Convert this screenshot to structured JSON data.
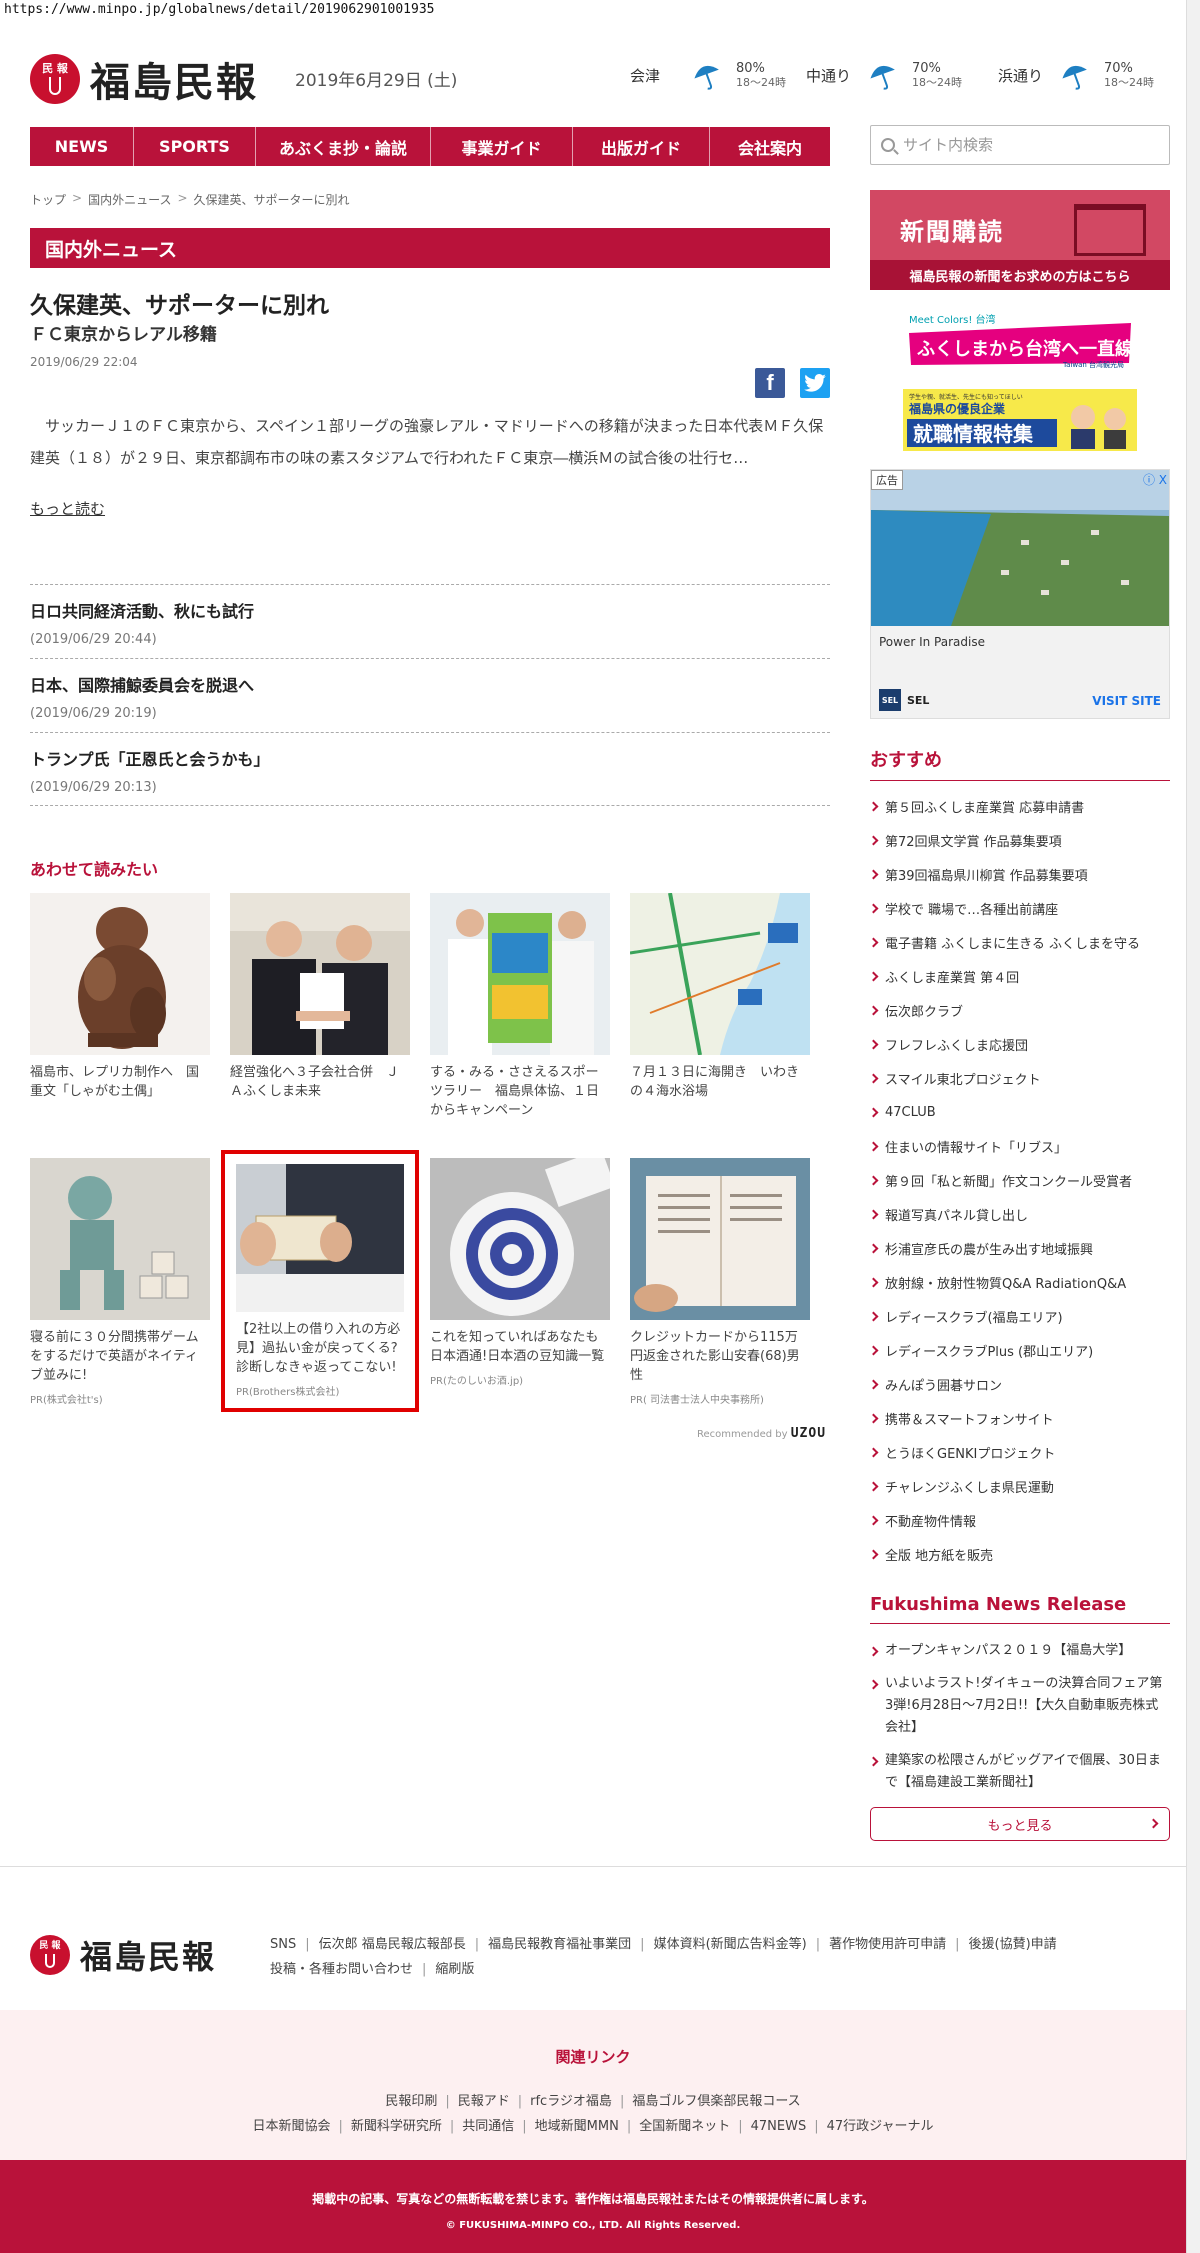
{
  "browser": {
    "url": "https://www.minpo.jp/globalnews/detail/2019062901001935"
  },
  "header": {
    "logo_mark_top": "民 報",
    "logo_text": "福島民報",
    "date": "2019年6月29日 (土)",
    "weather": [
      {
        "city": "会津",
        "percent": "80%",
        "time": "18〜24時"
      },
      {
        "city": "中通り",
        "percent": "70%",
        "time": "18〜24時"
      },
      {
        "city": "浜通り",
        "percent": "70%",
        "time": "18〜24時"
      }
    ]
  },
  "nav": {
    "items": [
      {
        "label": "NEWS"
      },
      {
        "label": "SPORTS"
      },
      {
        "label": "あぶくま抄・論説"
      },
      {
        "label": "事業ガイド"
      },
      {
        "label": "出版ガイド"
      },
      {
        "label": "会社案内"
      }
    ]
  },
  "search": {
    "placeholder": "サイト内検索"
  },
  "breadcrumb": {
    "items": [
      "トップ",
      "国内外ニュース",
      "久保建英、サポーターに別れ"
    ],
    "sep": ">"
  },
  "section": {
    "title": "国内外ニュース"
  },
  "article": {
    "title": "久保建英、サポーターに別れ",
    "subtitle": "ＦＣ東京からレアル移籍",
    "date": "2019/06/29 22:04",
    "share_fb": "f",
    "lead": "サッカーＪ１のＦＣ東京から、スペイン１部リーグの強豪レアル・マドリードへの移籍が決まった日本代表ＭＦ久保建英（１８）が２９日、東京都調布市の味の素スタジアムで行われたＦＣ東京―横浜Ｍの試合後の壮行セ…",
    "more": "もっと読む"
  },
  "news_list": [
    {
      "title": "日ロ共同経済活動、秋にも試行",
      "date": "(2019/06/29 20:44)"
    },
    {
      "title": "日本、国際捕鯨委員会を脱退へ",
      "date": "(2019/06/29 20:19)"
    },
    {
      "title": "トランプ氏「正恩氏と会うかも」",
      "date": "(2019/06/29 20:13)"
    }
  ],
  "read_together": {
    "heading": "あわせて読みたい",
    "cards": [
      {
        "caption": "福島市、レプリカ制作へ　国重文「しゃがむ土偶」",
        "pr": ""
      },
      {
        "caption": "経営強化へ３子会社合併　ＪＡふくしま未来",
        "pr": ""
      },
      {
        "caption": "する・みる・ささえるスポーツラリー　福島県体協、１日からキャンペーン",
        "pr": ""
      },
      {
        "caption": "７月１３日に海開き　いわきの４海水浴場",
        "pr": ""
      },
      {
        "caption": "寝る前に３０分間携帯ゲームをするだけで英語がネイティブ並みに!",
        "pr": "PR(株式会社t's)"
      },
      {
        "caption": "【2社以上の借り入れの方必見】過払い金が戻ってくる?診断しなきゃ返ってこない!",
        "pr": "PR(Brothers株式会社)"
      },
      {
        "caption": "これを知っていればあなたも日本酒通!日本酒の豆知識一覧",
        "pr": "PR(たのしいお酒.jp)"
      },
      {
        "caption": "クレジットカードから115万円返金された影山安春(68)男性",
        "pr": "PR( 司法書士法人中央事務所)"
      }
    ],
    "recommended_by": "Recommended by",
    "recommended_brand": "UZOU"
  },
  "sidebar": {
    "subscribe": {
      "title": "新聞購読",
      "bar": "福島民報の新聞をお求めの方はこちら"
    },
    "banner1": {
      "top": "Meet Colors! 台湾",
      "main": "ふくしまから台湾へ一直線!",
      "sub": "Taiwan 台湾観光局"
    },
    "banner2": {
      "small": "学生や親、就活生、先生にも知ってほしい",
      "main": "福島県の優良企業",
      "big": "就職情報特集"
    },
    "ad": {
      "label": "広告",
      "close": "ⓘ X",
      "text": "Power In Paradise",
      "brand_sq": "SEL",
      "brand": "SEL",
      "visit": "VISIT SITE"
    },
    "osusume": {
      "heading": "おすすめ",
      "items": [
        "第５回ふくしま産業賞 応募申請書",
        "第72回県文学賞 作品募集要項",
        "第39回福島県川柳賞 作品募集要項",
        "学校で 職場で…各種出前講座",
        "電子書籍 ふくしまに生きる ふくしまを守る",
        "ふくしま産業賞 第４回",
        "伝次郎クラブ",
        "フレフレふくしま応援団",
        "スマイル東北プロジェクト",
        "47CLUB",
        "住まいの情報サイト「リブス」",
        "第９回「私と新聞」作文コンクール受賞者",
        "報道写真パネル貸し出し",
        "杉浦宣彦氏の農が生み出す地域振興",
        "放射線・放射性物質Q&A RadiationQ&A",
        "レディースクラブ(福島エリア)",
        "レディースクラブPlus (郡山エリア)",
        "みんぽう囲碁サロン",
        "携帯＆スマートフォンサイト",
        "とうほくGENKIプロジェクト",
        "チャレンジふくしま県民運動",
        "不動産物件情報",
        "全版 地方紙を販売"
      ]
    },
    "release": {
      "heading": "Fukushima News Release",
      "items": [
        "オープンキャンパス２０１９【福島大学】",
        "いよいよラスト!ダイキューの決算合同フェア第3弾!6月28日〜7月2日!!【大久自動車販売株式会社】",
        "建築家の松隈さんがビッグアイで個展、30日まで【福島建設工業新聞社】"
      ],
      "more": "もっと見る"
    }
  },
  "footer": {
    "logo_text": "福島民報",
    "links_row1": [
      "SNS",
      "伝次郎 福島民報広報部長",
      "福島民報教育福祉事業団",
      "媒体資料(新聞広告料金等)",
      "著作物使用許可申請",
      "後援(協賛)申請"
    ],
    "links_row2": [
      "投稿・各種お問い合わせ",
      "縮刷版"
    ],
    "related": {
      "heading": "関連リンク",
      "row1": [
        "民報印刷",
        "民報アド",
        "rfcラジオ福島",
        "福島ゴルフ倶楽部民報コース"
      ],
      "row2": [
        "日本新聞協会",
        "新聞科学研究所",
        "共同通信",
        "地域新聞MMN",
        "全国新聞ネット",
        "47NEWS",
        "47行政ジャーナル"
      ]
    },
    "notice": "掲載中の記事、写真などの無断転載を禁じます。著作権は福島民報社またはその情報提供者に属します。",
    "copyright": "© FUKUSHIMA-MINPO CO., LTD. All Rights Reserved."
  },
  "colors": {
    "brand": "#b9123a",
    "subscribe": "#d24863",
    "highlight": "#e00000"
  }
}
